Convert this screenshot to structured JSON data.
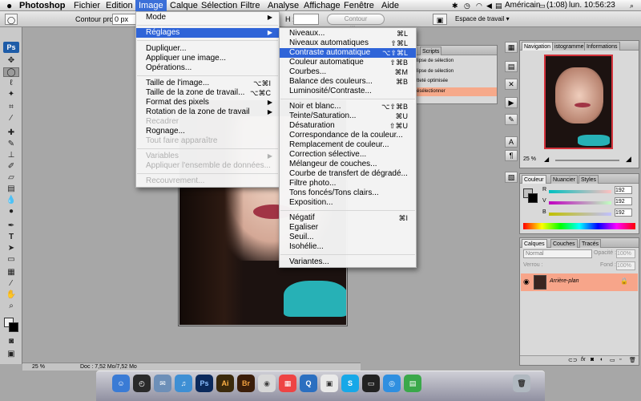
{
  "menubar": {
    "apple": "",
    "app": "Photoshop",
    "items": [
      "Fichier",
      "Edition",
      "Image",
      "Calque",
      "Sélection",
      "Filtre",
      "Analyse",
      "Affichage",
      "Fenêtre",
      "Aide"
    ],
    "active": "Image",
    "input_source": "Américain",
    "battery": "(1:08)",
    "clock": "lun. 10:56:23"
  },
  "optionsbar": {
    "contour_label": "Contour progr. :",
    "contour_value": "0 px",
    "mode_label": "Mode",
    "h_label": "H :",
    "h_value": "",
    "improve_button": "Contour améliorer...",
    "workspace": "Espace de travail ▾"
  },
  "image_menu": {
    "items": [
      {
        "label": "Mode",
        "submenu": true
      },
      {
        "label": "Réglages",
        "submenu": true,
        "highlighted": true
      },
      {
        "label": "Dupliquer..."
      },
      {
        "label": "Appliquer une image..."
      },
      {
        "label": "Opérations..."
      },
      {
        "label": "Taille de l'image...",
        "shortcut": "⌥⌘I"
      },
      {
        "label": "Taille de la zone de travail...",
        "shortcut": "⌥⌘C"
      },
      {
        "label": "Format des pixels",
        "submenu": true
      },
      {
        "label": "Rotation de la zone de travail",
        "submenu": true
      },
      {
        "label": "Recadrer",
        "disabled": true
      },
      {
        "label": "Rognage..."
      },
      {
        "label": "Tout faire apparaître",
        "disabled": true
      },
      {
        "label": "Variables",
        "disabled": true,
        "submenu": true
      },
      {
        "label": "Appliquer l'ensemble de données...",
        "disabled": true
      },
      {
        "label": "Recouvrement...",
        "disabled": true
      }
    ]
  },
  "reglages_submenu": {
    "items": [
      {
        "label": "Niveaux...",
        "shortcut": "⌘L"
      },
      {
        "label": "Niveaux automatiques",
        "shortcut": "⇧⌘L"
      },
      {
        "label": "Contraste automatique",
        "shortcut": "⌥⇧⌘L",
        "highlighted": true
      },
      {
        "label": "Couleur automatique",
        "shortcut": "⇧⌘B"
      },
      {
        "label": "Courbes...",
        "shortcut": "⌘M"
      },
      {
        "label": "Balance des couleurs...",
        "shortcut": "⌘B"
      },
      {
        "label": "Luminosité/Contraste..."
      },
      {
        "label": "Noir et blanc...",
        "shortcut": "⌥⇧⌘B"
      },
      {
        "label": "Teinte/Saturation...",
        "shortcut": "⌘U"
      },
      {
        "label": "Désaturation",
        "shortcut": "⇧⌘U"
      },
      {
        "label": "Correspondance de la couleur..."
      },
      {
        "label": "Remplacement de couleur..."
      },
      {
        "label": "Correction sélective..."
      },
      {
        "label": "Mélangeur de couches..."
      },
      {
        "label": "Courbe de transfert de dégradé..."
      },
      {
        "label": "Filtre photo..."
      },
      {
        "label": "Tons foncés/Tons clairs..."
      },
      {
        "label": "Exposition..."
      },
      {
        "label": "Négatif",
        "shortcut": "⌘I"
      },
      {
        "label": "Egaliser"
      },
      {
        "label": "Seuil..."
      },
      {
        "label": "Isohélie..."
      },
      {
        "label": "Variantes..."
      }
    ]
  },
  "history_panel": {
    "tab": "Scripts",
    "rows": [
      "lipse de sélection",
      "lipse de sélection",
      "tteté optimisée",
      "ésélectionner"
    ]
  },
  "navigator_panel": {
    "tabs": [
      "Navigation",
      "istogramme",
      "Informations"
    ],
    "zoom": "25 %"
  },
  "color_panel": {
    "tabs": [
      "Couleur",
      "Nuancier",
      "Styles"
    ],
    "channels": [
      {
        "label": "R",
        "value": "192"
      },
      {
        "label": "V",
        "value": "192"
      },
      {
        "label": "B",
        "value": "192"
      }
    ]
  },
  "layers_panel": {
    "tabs": [
      "Calques",
      "Couches",
      "Tracés"
    ],
    "blend_mode": "Normal",
    "opacity_label": "Opacité :",
    "opacity_value": "100%",
    "lock_label": "Verrou :",
    "fill_label": "Fond :",
    "fill_value": "100%",
    "layer_name": "Arrière-plan"
  },
  "statusbar": {
    "zoom": "25 %",
    "doc": "Doc : 7,52 Mo/7,52 Mo"
  },
  "dock": {
    "apps": [
      "Finder",
      "Dashboard",
      "Mail",
      "iTunes",
      "Photoshop",
      "Illustrator",
      "Bridge",
      "Photo Booth",
      "Calendar",
      "QuickTime",
      "Preview",
      "Skype",
      "Terminal",
      "Safari",
      "Numbers",
      "Trash"
    ]
  }
}
